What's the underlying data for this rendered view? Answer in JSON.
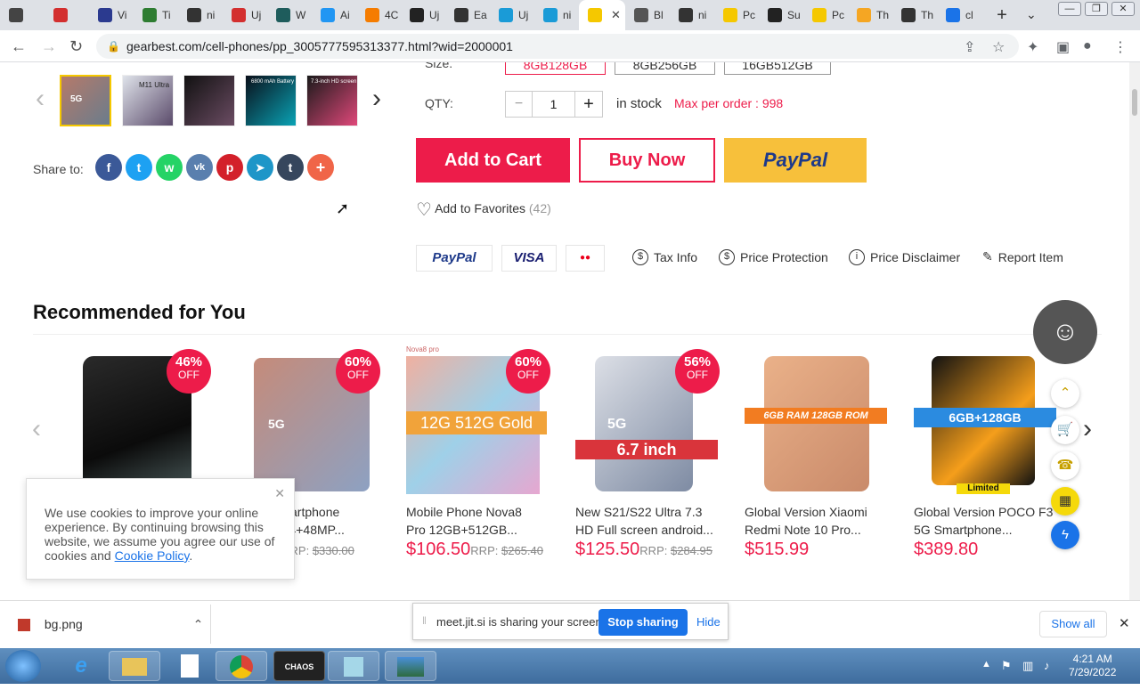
{
  "browser": {
    "tabs": [
      {
        "label": "",
        "color": "#444"
      },
      {
        "label": "",
        "color": "#d32f2f"
      },
      {
        "label": "Vi",
        "color": "#2b3a8f"
      },
      {
        "label": "Ti",
        "color": "#2e7d32"
      },
      {
        "label": "ni",
        "color": "#333"
      },
      {
        "label": "Uj",
        "color": "#d32f2f"
      },
      {
        "label": "W",
        "color": "#1e5c5c"
      },
      {
        "label": "Ai",
        "color": "#2196f3"
      },
      {
        "label": "4C",
        "color": "#f57c00"
      },
      {
        "label": "Uj",
        "color": "#222"
      },
      {
        "label": "Ea",
        "color": "#333"
      },
      {
        "label": "Uj",
        "color": "#1a9bd7"
      },
      {
        "label": "ni",
        "color": "#1a9bd7"
      },
      {
        "label": "",
        "color": "#f5c800",
        "active": true
      },
      {
        "label": "Bl",
        "color": "#555"
      },
      {
        "label": "ni",
        "color": "#333"
      },
      {
        "label": "Pc",
        "color": "#f5c800"
      },
      {
        "label": "Su",
        "color": "#222"
      },
      {
        "label": "Pc",
        "color": "#f5c800"
      },
      {
        "label": "Th",
        "color": "#f5a623"
      },
      {
        "label": "Th",
        "color": "#333"
      },
      {
        "label": "cl",
        "color": "#1a73e8"
      }
    ],
    "new_tab": "+",
    "tab_close": "✕",
    "url": "gearbest.com/cell-phones/pp_3005777595313377.html?wid=2000001"
  },
  "product": {
    "size_options": [
      "8GB128GB",
      "8GB256GB",
      "16GB512GB"
    ],
    "size_label": "Size:",
    "qty_label": "QTY:",
    "qty_value": "1",
    "qty_minus": "−",
    "qty_plus": "+",
    "stock_text": "in stock",
    "max_order": "Max per order : 998",
    "share_label": "Share to:",
    "add_to_cart": "Add to Cart",
    "buy_now": "Buy Now",
    "paypal_button": "PayPal",
    "add_to_favorites": "Add to Favorites",
    "favorites_count": "(42)",
    "payment_logos": [
      "PayPal",
      "VISA",
      "●●"
    ],
    "policies": [
      "Tax Info",
      "Price Protection",
      "Price Disclaimer",
      "Report Item"
    ],
    "thumb_labels": [
      "5G",
      "M11 Ultra",
      "",
      "6800 mAh Battery",
      "7.3-inch HD screen"
    ]
  },
  "recommended": {
    "title": "Recommended for You",
    "items": [
      {
        "badge_pct": "46%",
        "badge_off": "OFF",
        "title_line1": "",
        "title_line2": "",
        "price": "",
        "rrp": "",
        "overlay": "",
        "color": "#1b1b1b"
      },
      {
        "badge_pct": "60%",
        "badge_off": "OFF",
        "title_line1": "Smartphone",
        "title_line2": "3 24+48MP...",
        "price": "0",
        "rrp_label": "RRP:",
        "rrp": "$330.00",
        "overlay": "5G",
        "color": "#b57a6a"
      },
      {
        "badge_pct": "60%",
        "badge_off": "OFF",
        "title_line1": "Mobile Phone Nova8",
        "title_line2": "Pro 12GB+512GB...",
        "price": "$106.50",
        "rrp_label": "RRP:",
        "rrp": "$265.40",
        "overlay": "12G 512G Gold",
        "top_label": "Nova8 pro",
        "color": "#e8a3c6"
      },
      {
        "badge_pct": "56%",
        "badge_off": "OFF",
        "title_line1": "New S21/S22 Ultra 7.3",
        "title_line2": "HD Full screen android...",
        "price": "$125.50",
        "rrp_label": "RRP:",
        "rrp": "$284.95",
        "overlay": "6.7 inch",
        "overlay2": "5G",
        "color": "#c9ccd4"
      },
      {
        "badge_pct": "",
        "badge_off": "",
        "title_line1": "Global Version Xiaomi",
        "title_line2": "Redmi Note 10 Pro...",
        "price": "$515.99",
        "rrp_label": "",
        "rrp": "",
        "overlay": "6GB RAM 128GB ROM",
        "color": "#e9a577"
      },
      {
        "badge_pct": "",
        "badge_off": "",
        "title_line1": "Global Version POCO F3",
        "title_line2": "5G Smartphone...",
        "price": "$389.80",
        "rrp_label": "",
        "rrp": "",
        "overlay": "6GB+128GB",
        "sub_label": "Limited",
        "color": "#111"
      }
    ]
  },
  "cookie": {
    "text": "We use cookies to improve your online experience. By continuing browsing this website, we assume you agree our use of cookies and",
    "link": "Cookie Policy",
    "end": ".",
    "close": "✕"
  },
  "downloads": {
    "file": "bg.png",
    "show_all": "Show all",
    "close": "✕"
  },
  "screen_share": {
    "text": "meet.jit.si is sharing your screen.",
    "stop": "Stop sharing",
    "hide": "Hide"
  },
  "taskbar": {
    "apps": [
      "e",
      "",
      "",
      "",
      "CHAOS",
      "",
      ""
    ],
    "time": "4:21 AM",
    "date": "7/29/2022"
  },
  "colors": {
    "accent_red": "#ed1c4a",
    "paypal_yellow": "#f7c03b",
    "thumb_selected": "#f5c800",
    "messenger_blue": "#1a73e8"
  }
}
